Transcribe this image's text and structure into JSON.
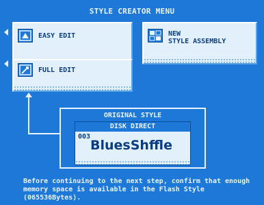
{
  "header": {
    "title": "STYLE CREATOR MENU"
  },
  "menu": {
    "easy_edit": {
      "label": "EASY EDIT",
      "icon": "easy-edit-icon"
    },
    "full_edit": {
      "label": "FULL EDIT",
      "icon": "full-edit-icon"
    },
    "new_style_assembly": {
      "label": "NEW\nSTYLE ASSEMBLY",
      "icon": "style-assembly-icon"
    }
  },
  "original_style": {
    "heading": "ORIGINAL STYLE",
    "source": "DISK DIRECT",
    "number": "003",
    "name": "BluesShffle"
  },
  "notice": {
    "text": "Before continuing to the next step, confirm that enough memory space is available in the Flash Style (065536Bytes)."
  },
  "colors": {
    "background": "#1e78d8",
    "panel": "#e2f0fb",
    "text_dark": "#0a3d80",
    "text_light": "#eaf4ff"
  }
}
